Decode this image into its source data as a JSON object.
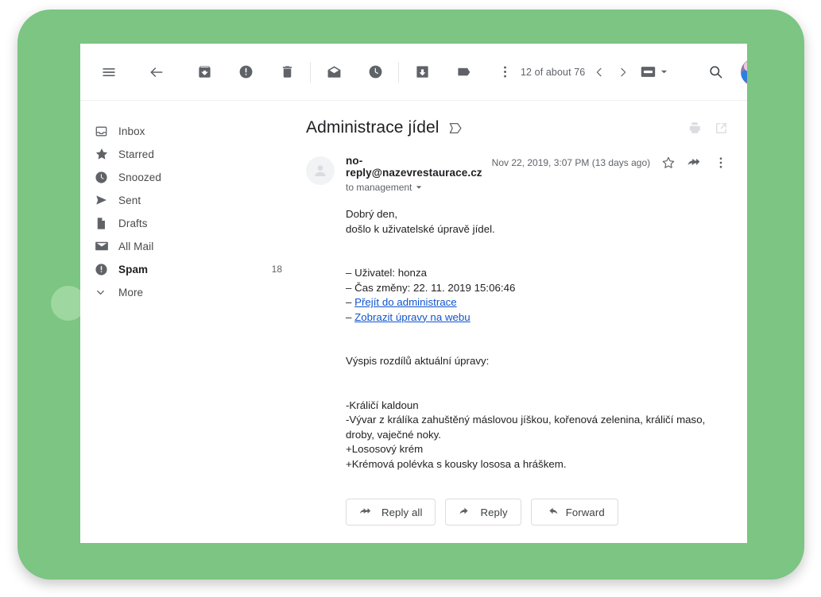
{
  "theme": {
    "panel_green": "#7cc582",
    "deco_circle_green": "#9ed79f",
    "card_white": "#ffffff",
    "link_blue": "#1155cc",
    "icon_gray": "#5f6368",
    "text_primary": "#202124"
  },
  "toolbar": {
    "menu_label": "Main menu",
    "back_label": "Back to Inbox",
    "archive_label": "Archive",
    "report_spam_label": "Report spam",
    "delete_label": "Delete",
    "mark_unread_label": "Mark as unread",
    "snooze_label": "Snooze",
    "move_to_label": "Move to",
    "labels_label": "Labels",
    "more_label": "More",
    "count_text": "12 of about 76",
    "newer_label": "Newer",
    "older_label": "Older",
    "density_label": "Display density",
    "search_label": "Search mail",
    "account_label": "Google Account"
  },
  "sidebar": {
    "items": [
      {
        "label": "Inbox",
        "icon": "inbox-icon",
        "count": "",
        "active": false
      },
      {
        "label": "Starred",
        "icon": "star-icon",
        "count": "",
        "active": false
      },
      {
        "label": "Snoozed",
        "icon": "clock-icon",
        "count": "",
        "active": false
      },
      {
        "label": "Sent",
        "icon": "send-icon",
        "count": "",
        "active": false
      },
      {
        "label": "Drafts",
        "icon": "draft-icon",
        "count": "",
        "active": false
      },
      {
        "label": "All Mail",
        "icon": "envelope-icon",
        "count": "",
        "active": false
      },
      {
        "label": "Spam",
        "icon": "alert-icon",
        "count": "18",
        "active": true
      },
      {
        "label": "More",
        "icon": "chevron-down-icon",
        "count": "",
        "active": false
      }
    ]
  },
  "message": {
    "subject": "Administrace jídel",
    "subject_icon": "inbox-label-icon",
    "print_label": "Print all",
    "popout_label": "Open in new window",
    "sender": "no-reply@nazevrestaurace.cz",
    "recipient": "to management",
    "date": "Nov 22, 2019, 3:07 PM (13 days ago)",
    "star_label": "Not starred",
    "reply_icon_label": "Reply",
    "more_label": "More",
    "body": {
      "line1": "Dobrý den,",
      "line2": "došlo k uživatelské úpravě jídel.",
      "line3": "– Uživatel: honza",
      "line4": "– Čas změny: 22. 11. 2019 15:06:46",
      "link1_prefix": "– ",
      "link1": "Přejít do administrace",
      "link2_prefix": "– ",
      "link2": "Zobrazit úpravy na webu",
      "line5": "Výspis rozdílů aktuální úpravy:",
      "line6": "-Králičí kaldoun",
      "line7": "-Vývar z králíka zahuštěný máslovou jíškou, kořenová zelenina, králičí maso, droby, vaječné noky.",
      "line8": "+Lososový krém",
      "line9": "+Krémová polévka s kousky lososa a hráškem."
    }
  },
  "actions": {
    "reply_all": "Reply all",
    "reply": "Reply",
    "forward": "Forward"
  }
}
